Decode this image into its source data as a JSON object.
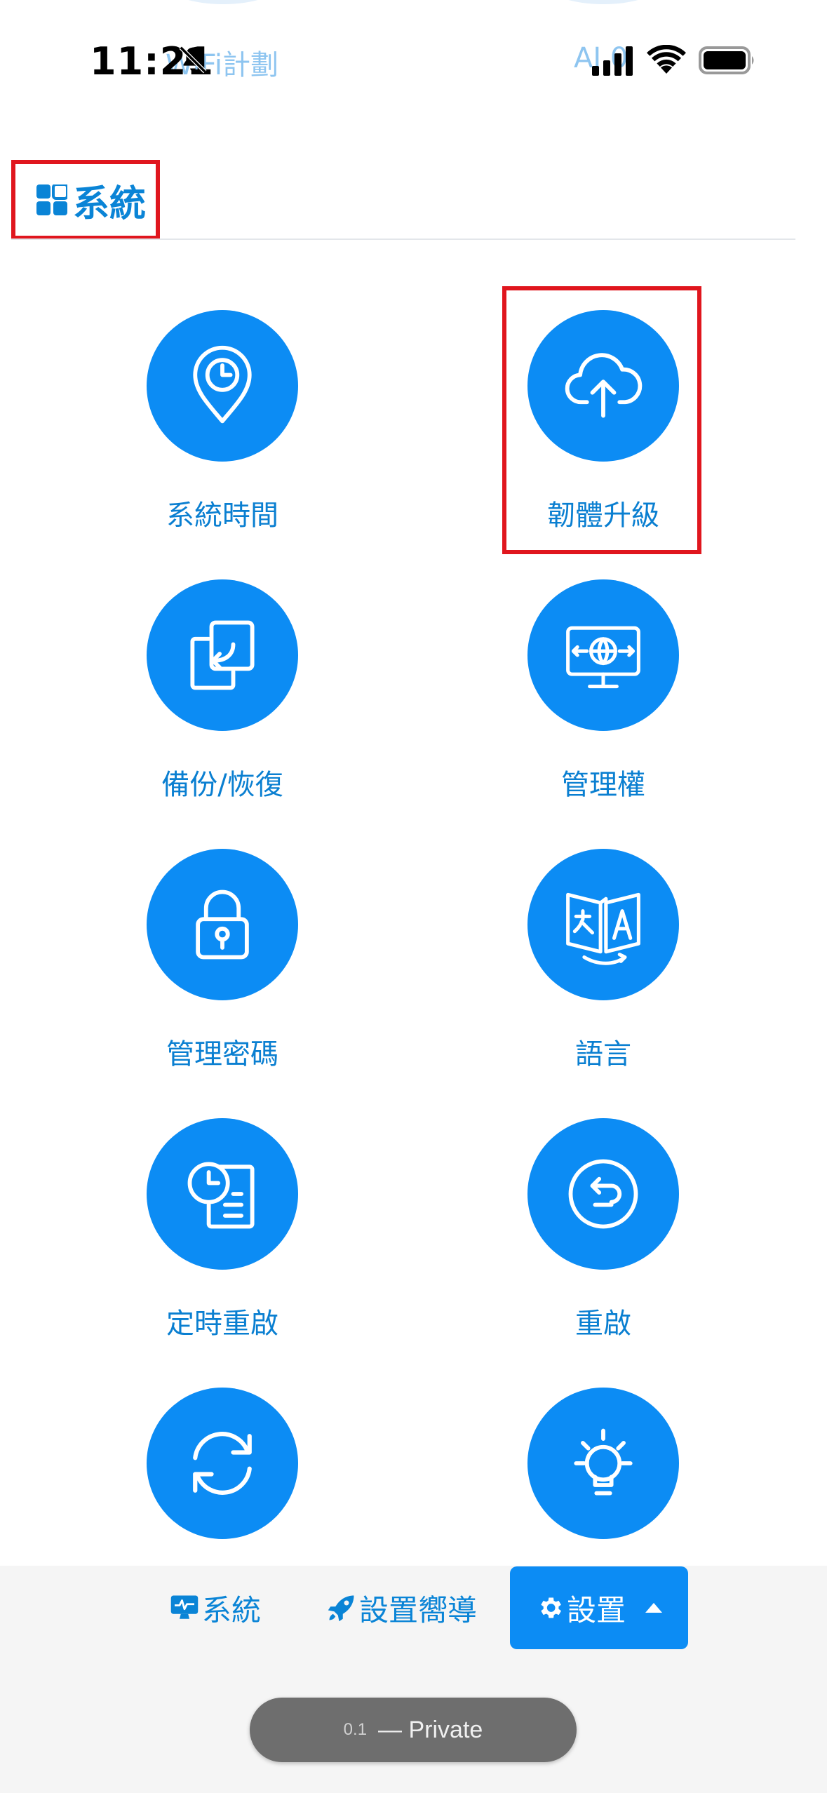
{
  "status_bar": {
    "time": "11:21",
    "ghost_left_text": "WiFi計劃",
    "ghost_right_text": "AI.0"
  },
  "section": {
    "title": "系統",
    "icon": "grid-icon"
  },
  "tiles": [
    {
      "label": "系統時間",
      "icon": "map-pin-clock-icon"
    },
    {
      "label": "韌體升級",
      "icon": "cloud-upload-icon"
    },
    {
      "label": "備份/恢復",
      "icon": "backup-restore-icon"
    },
    {
      "label": "管理權",
      "icon": "monitor-globe-icon"
    },
    {
      "label": "管理密碼",
      "icon": "padlock-icon"
    },
    {
      "label": "語言",
      "icon": "translate-icon"
    },
    {
      "label": "定時重啟",
      "icon": "scheduled-reboot-icon"
    },
    {
      "label": "重啟",
      "icon": "reboot-icon"
    },
    {
      "label": "",
      "icon": "refresh-icon"
    },
    {
      "label": "",
      "icon": "lightbulb-icon"
    }
  ],
  "bottom_bar": {
    "system_label": "系統",
    "wizard_label": "設置嚮導",
    "settings_label": "設置"
  },
  "browser": {
    "url_fragment": "0.1",
    "mode_label": "— Private"
  },
  "colors": {
    "accent": "#0c8cf4",
    "text_blue": "#0a84d6",
    "highlight_red": "#e0161e"
  }
}
